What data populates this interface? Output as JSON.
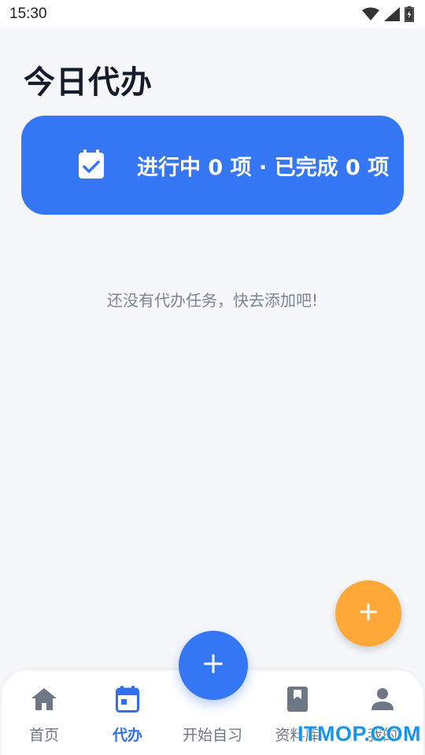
{
  "status_bar": {
    "time": "15:30",
    "icons": [
      "wifi-icon",
      "signal-icon",
      "battery-charging-icon"
    ]
  },
  "page": {
    "title": "今日代办"
  },
  "summary": {
    "icon": "calendar-check-icon",
    "text": "进行中 0 项 · 已完成 0 项"
  },
  "empty_state": {
    "message": "还没有代办任务，快去添加吧!"
  },
  "fab": {
    "icon": "plus-icon",
    "color": "#ffa737"
  },
  "bottom_nav": {
    "items": [
      {
        "label": "首页",
        "icon": "home-icon",
        "active": false
      },
      {
        "label": "代办",
        "icon": "calendar-icon",
        "active": true
      },
      {
        "label": "开始自习",
        "icon": "plus-icon",
        "active": false
      },
      {
        "label": "资料库",
        "icon": "book-icon",
        "active": false
      },
      {
        "label": "我的",
        "icon": "person-icon",
        "active": false
      }
    ]
  },
  "watermark": {
    "text": "ITMOP.COM"
  },
  "colors": {
    "accent": "#3476f4",
    "fab_orange": "#ffa737",
    "background": "#f5f7fb"
  }
}
